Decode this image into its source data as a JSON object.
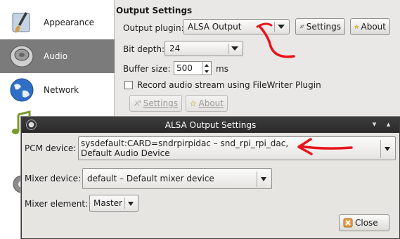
{
  "sidebar": {
    "items": [
      {
        "label": "Appearance",
        "icon": "paintbrush-icon"
      },
      {
        "label": "Audio",
        "icon": "speaker-icon"
      },
      {
        "label": "Network",
        "icon": "globe-icon"
      },
      {
        "label": "",
        "icon": "music-note-icon"
      },
      {
        "label": "",
        "icon": "gear-icon"
      }
    ]
  },
  "output": {
    "section_title": "Output Settings",
    "plugin_label": "Output plugin:",
    "plugin_value": "ALSA Output",
    "settings_button": "Settings",
    "about_button": "About",
    "bit_depth_label": "Bit depth:",
    "bit_depth_value": "24",
    "buffer_label": "Buffer size:",
    "buffer_value": "500",
    "buffer_unit": "ms",
    "record_label": "Record audio stream using FileWriter Plugin",
    "record_settings_button": "Settings",
    "record_about_button": "About"
  },
  "dialog": {
    "title": "ALSA Output Settings",
    "pcm_label": "PCM device:",
    "pcm_value_line1": "sysdefault:CARD=sndrpirpidac – snd_rpi_rpi_dac,",
    "pcm_value_line2": "Default Audio Device",
    "mixer_label": "Mixer device:",
    "mixer_value": "default – Default mixer device",
    "element_label": "Mixer element:",
    "element_value": "Master",
    "close_button": "Close"
  },
  "colors": {
    "annotation_red": "#e8141a",
    "selected_sidebar": "#7b7b7b",
    "titlebar": "#2f2f2f"
  }
}
